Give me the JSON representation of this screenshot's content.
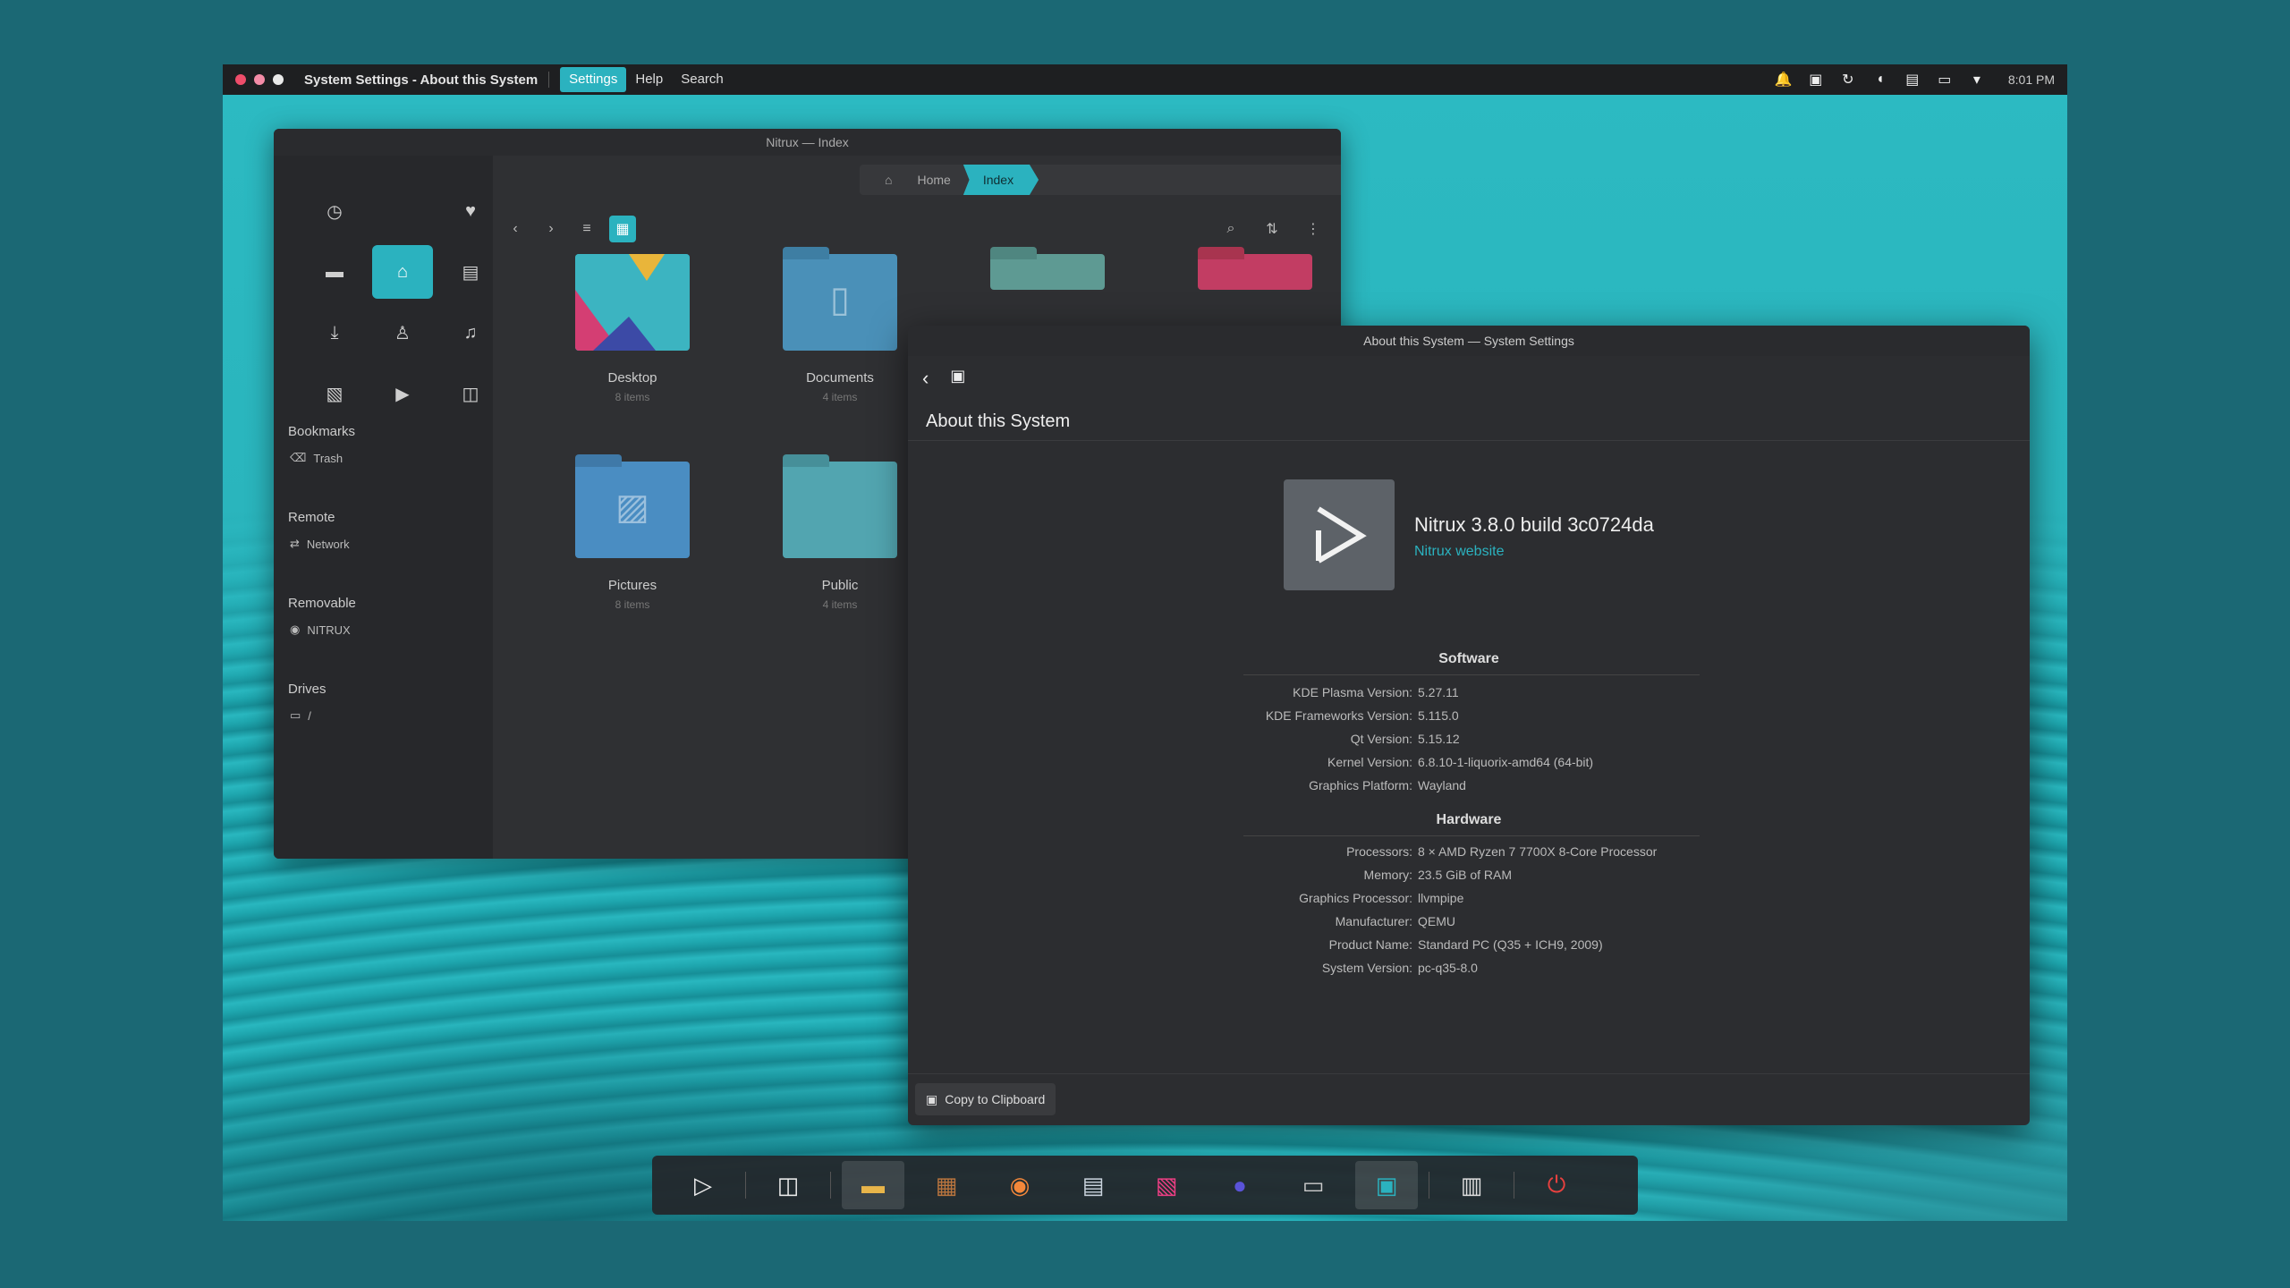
{
  "top_panel": {
    "window_title": "System Settings - About this System",
    "menus": [
      "Settings",
      "Help",
      "Search"
    ],
    "active_menu": "Settings",
    "clock": "8:01 PM"
  },
  "file_manager": {
    "title": "Nitrux — Index",
    "breadcrumb": [
      "Home",
      "Index"
    ],
    "sidebar": {
      "sections": [
        {
          "label": "Bookmarks",
          "entry": "Trash"
        },
        {
          "label": "Remote",
          "entry": "Network"
        },
        {
          "label": "Removable",
          "entry": "NITRUX"
        },
        {
          "label": "Drives",
          "entry": "/"
        }
      ]
    },
    "files": [
      {
        "name": "Desktop",
        "meta": "8 items"
      },
      {
        "name": "Documents",
        "meta": "4 items"
      },
      {
        "name": "Pictures",
        "meta": "8 items"
      },
      {
        "name": "Public",
        "meta": "4 items"
      }
    ]
  },
  "about": {
    "window_title": "About this System — System Settings",
    "heading": "About this System",
    "os_name": "Nitrux 3.8.0 build 3c0724da",
    "os_link": "Nitrux website",
    "software_title": "Software",
    "software": [
      {
        "k": "KDE Plasma Version:",
        "v": "5.27.11"
      },
      {
        "k": "KDE Frameworks Version:",
        "v": "5.115.0"
      },
      {
        "k": "Qt Version:",
        "v": "5.15.12"
      },
      {
        "k": "Kernel Version:",
        "v": "6.8.10-1-liquorix-amd64 (64-bit)"
      },
      {
        "k": "Graphics Platform:",
        "v": "Wayland"
      }
    ],
    "hardware_title": "Hardware",
    "hardware": [
      {
        "k": "Processors:",
        "v": "8 × AMD Ryzen 7 7700X 8-Core Processor"
      },
      {
        "k": "Memory:",
        "v": "23.5 GiB of RAM"
      },
      {
        "k": "Graphics Processor:",
        "v": "llvmpipe"
      },
      {
        "k": "Manufacturer:",
        "v": "QEMU"
      },
      {
        "k": "Product Name:",
        "v": "Standard PC (Q35 + ICH9, 2009)"
      },
      {
        "k": "System Version:",
        "v": "pc-q35-8.0"
      }
    ],
    "copy_button": "Copy to Clipboard"
  },
  "colors": {
    "accent": "#2bb2bf",
    "folder_blue": "#4a90b8",
    "folder_teal": "#52a5b0",
    "folder_pink": "#c23d63"
  }
}
